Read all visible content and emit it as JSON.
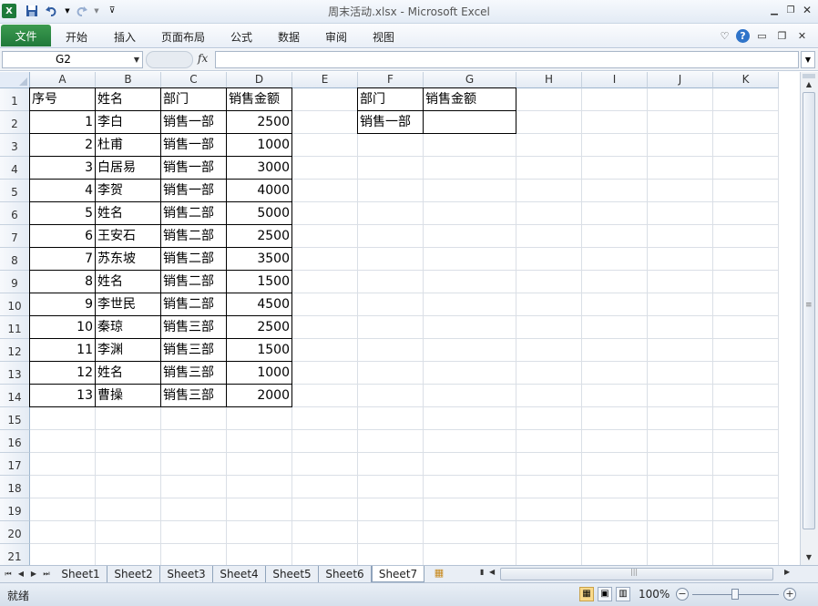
{
  "window": {
    "title": "周末活动.xlsx  -  Microsoft Excel",
    "app_icon": "excel-logo-icon"
  },
  "quick_access": [
    "save-icon",
    "undo-icon",
    "redo-icon",
    "customize-icon"
  ],
  "ribbon": {
    "file_tab": "文件",
    "tabs": [
      "开始",
      "插入",
      "页面布局",
      "公式",
      "数据",
      "审阅",
      "视图"
    ]
  },
  "formula_bar": {
    "name_box": "G2",
    "fx_label": "fx",
    "formula": ""
  },
  "grid": {
    "columns": [
      "A",
      "B",
      "C",
      "D",
      "E",
      "F",
      "G",
      "H",
      "I",
      "J",
      "K"
    ],
    "rows": [
      "1",
      "2",
      "3",
      "4",
      "5",
      "6",
      "7",
      "8",
      "9",
      "10",
      "11",
      "12",
      "13",
      "14",
      "15",
      "16",
      "17",
      "18",
      "19",
      "20",
      "21"
    ],
    "table1": {
      "header": [
        "序号",
        "姓名",
        "部门",
        "销售金额"
      ],
      "rows": [
        [
          "1",
          "李白",
          "销售一部",
          "2500"
        ],
        [
          "2",
          "杜甫",
          "销售一部",
          "1000"
        ],
        [
          "3",
          "白居易",
          "销售一部",
          "3000"
        ],
        [
          "4",
          "李贺",
          "销售一部",
          "4000"
        ],
        [
          "5",
          "姓名",
          "销售二部",
          "5000"
        ],
        [
          "6",
          "王安石",
          "销售二部",
          "2500"
        ],
        [
          "7",
          "苏东坡",
          "销售二部",
          "3500"
        ],
        [
          "8",
          "姓名",
          "销售二部",
          "1500"
        ],
        [
          "9",
          "李世民",
          "销售二部",
          "4500"
        ],
        [
          "10",
          "秦琼",
          "销售三部",
          "2500"
        ],
        [
          "11",
          "李渊",
          "销售三部",
          "1500"
        ],
        [
          "12",
          "姓名",
          "销售三部",
          "1000"
        ],
        [
          "13",
          "曹操",
          "销售三部",
          "2000"
        ]
      ]
    },
    "table2": {
      "header": [
        "部门",
        "销售金额"
      ],
      "rows": [
        [
          "销售一部",
          ""
        ]
      ]
    }
  },
  "sheets": {
    "tabs": [
      "Sheet1",
      "Sheet2",
      "Sheet3",
      "Sheet4",
      "Sheet5",
      "Sheet6",
      "Sheet7"
    ],
    "active": "Sheet7"
  },
  "status_bar": {
    "ready": "就绪",
    "zoom": "100%"
  }
}
